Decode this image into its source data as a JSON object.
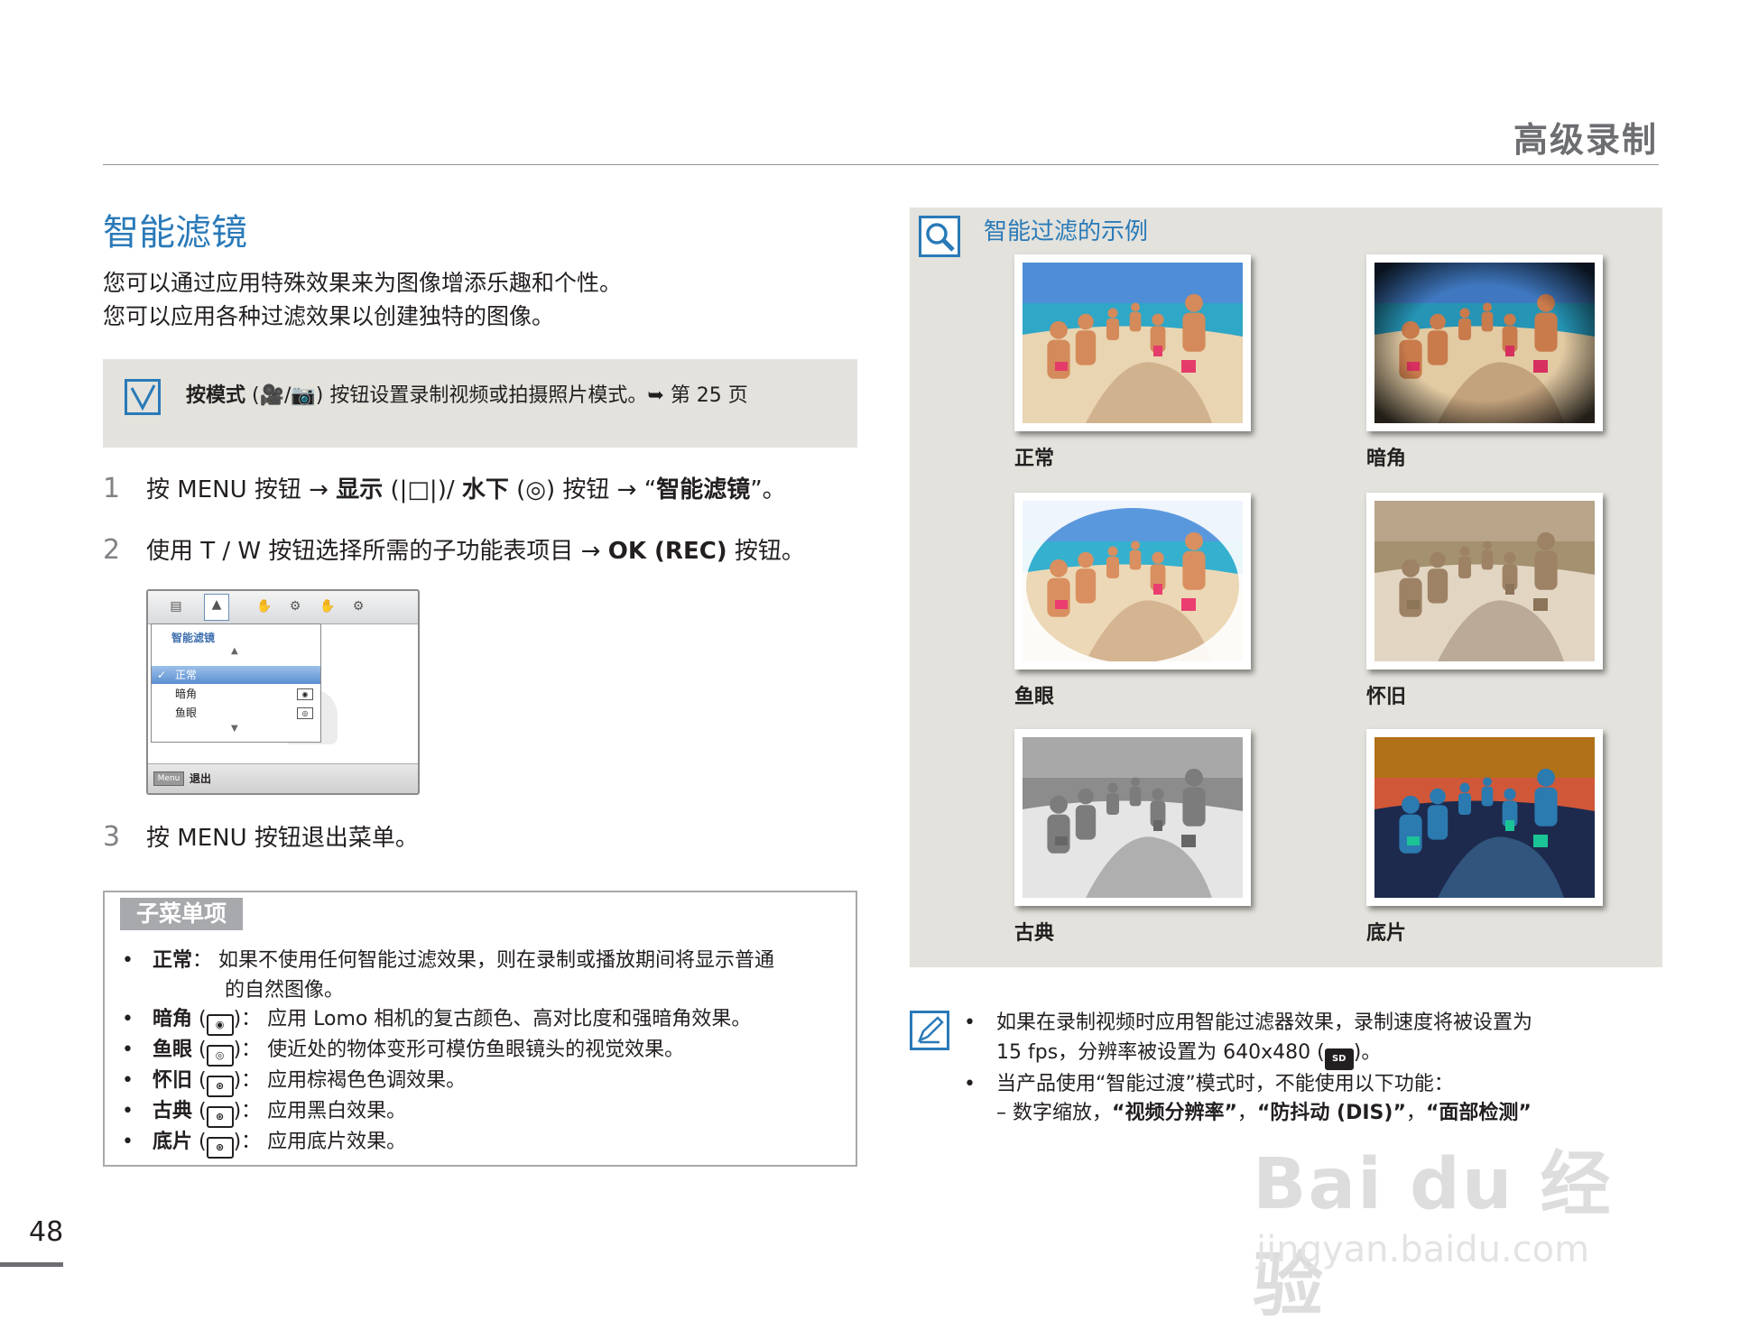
{
  "header": {
    "section_title": "高级录制"
  },
  "page": {
    "title": "智能滤镜",
    "intro_line1": "您可以通过应用特殊效果来为图像增添乐趣和个性。",
    "intro_line2": "您可以应用各种过滤效果以创建独特的图像。",
    "number": "48"
  },
  "note": {
    "bold": "按模式",
    "paren_open": " (",
    "paren_close": ") ",
    "mode_icons": "🎥/📷",
    "text": "按钮设置录制视频或拍摄照片模式。",
    "ref": "➥ 第 25 页"
  },
  "steps": [
    {
      "num": "1",
      "pre": "按 MENU 按钮  → ",
      "b1": "显示",
      "mid1": " (|□|)/ ",
      "b2": "水下",
      "mid2": " (◎) 按钮  → “",
      "b3": "智能滤镜",
      "post": "”。"
    },
    {
      "num": "2",
      "pre": "使用 T / W 按钮选择所需的子功能表项目 → ",
      "b1": "OK (REC)",
      "post": " 按钮。"
    },
    {
      "num": "3",
      "pre": "按 MENU 按钮退出菜单。"
    }
  ],
  "menu_screen": {
    "tabs": [
      "▤",
      "▲",
      "✋",
      "⚙",
      "✋",
      "⚙"
    ],
    "header": "智能滤镜",
    "items": [
      {
        "label": "正常",
        "checked": "✓"
      },
      {
        "label": "暗角",
        "icon": "◉"
      },
      {
        "label": "鱼眼",
        "icon": "◎"
      }
    ],
    "up_arrow": "▲",
    "down_arrow": "▼",
    "menu_button": "Menu",
    "exit": "退出"
  },
  "submenu": {
    "tag": "子菜单项",
    "bullet": "•",
    "items": [
      {
        "name": "正常",
        "sep": "： ",
        "desc": "如果不使用任何智能过滤效果，则在录制或播放期间将显示普通",
        "desc2": "的自然图像。"
      },
      {
        "name": "暗角",
        "icon": "◉",
        "desc": "应用 Lomo 相机的复古颜色、高对比度和强暗角效果。"
      },
      {
        "name": "鱼眼",
        "icon": "◎",
        "desc": "使近处的物体变形可模仿鱼眼镜头的视觉效果。"
      },
      {
        "name": "怀旧",
        "icon": "⊛",
        "desc": "应用棕褐色色调效果。"
      },
      {
        "name": "古典",
        "icon": "⊛",
        "desc": "应用黑白效果。"
      },
      {
        "name": "底片",
        "icon": "⊛",
        "desc": "应用底片效果。"
      }
    ]
  },
  "examples": {
    "title": "智能过滤的示例",
    "items": [
      {
        "caption": "正常",
        "filter": "normal"
      },
      {
        "caption": "暗角",
        "filter": "vignette"
      },
      {
        "caption": "鱼眼",
        "filter": "fisheye"
      },
      {
        "caption": "怀旧",
        "filter": "sepia"
      },
      {
        "caption": "古典",
        "filter": "bw"
      },
      {
        "caption": "底片",
        "filter": "negative"
      }
    ]
  },
  "bottom_notes": {
    "bullet": "•",
    "line1a": "如果在录制视频时应用智能过滤器效果，录制速度将被设置为",
    "line1b": "15  fps，分辨率被设置为  640x480 (",
    "sd_icon": "SD",
    "line1c": ")。",
    "line2": "当产品使用“智能过渡”模式时，不能使用以下功能：",
    "line3_pre": "–  数字缩放，",
    "line3_b1": "“视频分辨率”",
    "line3_sep1": "，",
    "line3_b2": "“防抖动 (DIS)”",
    "line3_sep2": "，",
    "line3_b3": "“面部检测”"
  },
  "watermark": {
    "logo": "Bai du 经验",
    "url": "jingyan.baidu.com"
  },
  "colors": {
    "accent": "#2a7ab8",
    "box_bg": "#e3e2dc",
    "gray": "#a7a9ac"
  }
}
